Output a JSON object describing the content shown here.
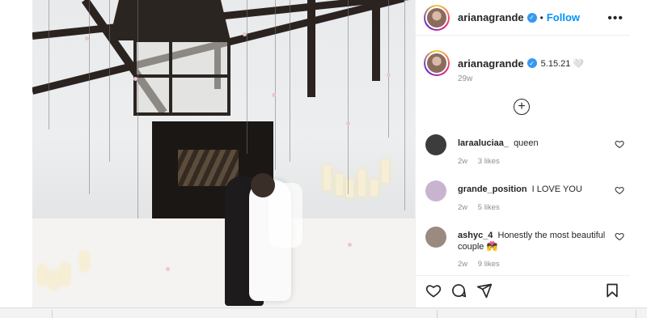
{
  "post": {
    "username": "ariana­grande",
    "follow_label": "Follow",
    "dot": "•",
    "more_label": "•••",
    "caption_user": "arianagrande",
    "caption_text": "5.15.21 🤍",
    "caption_time": "29w"
  },
  "comments": [
    {
      "user": "laraaluciaa_",
      "text": "queen",
      "time": "2w",
      "likes": "3 likes",
      "avatar_color": "#3c3c3c"
    },
    {
      "user": "grande_position",
      "text": "I LOVE YOU",
      "time": "2w",
      "likes": "5 likes",
      "avatar_color": "#c9b4d0"
    },
    {
      "user": "ashyc_4",
      "text": "Honestly the most beautiful couple 💏",
      "time": "2w",
      "likes": "9 likes",
      "avatar_color": "#9a8a80"
    }
  ],
  "icons": {
    "heart": "heart-icon",
    "comment": "comment-icon",
    "share": "share-icon",
    "save": "bookmark-icon",
    "more": "more-icon",
    "add_comment": "plus-circle-icon",
    "next": "chevron-right-icon"
  },
  "colors": {
    "accent": "#0095f6",
    "verified": "#3897f0",
    "text": "#262626",
    "muted": "#8e8e8e"
  }
}
